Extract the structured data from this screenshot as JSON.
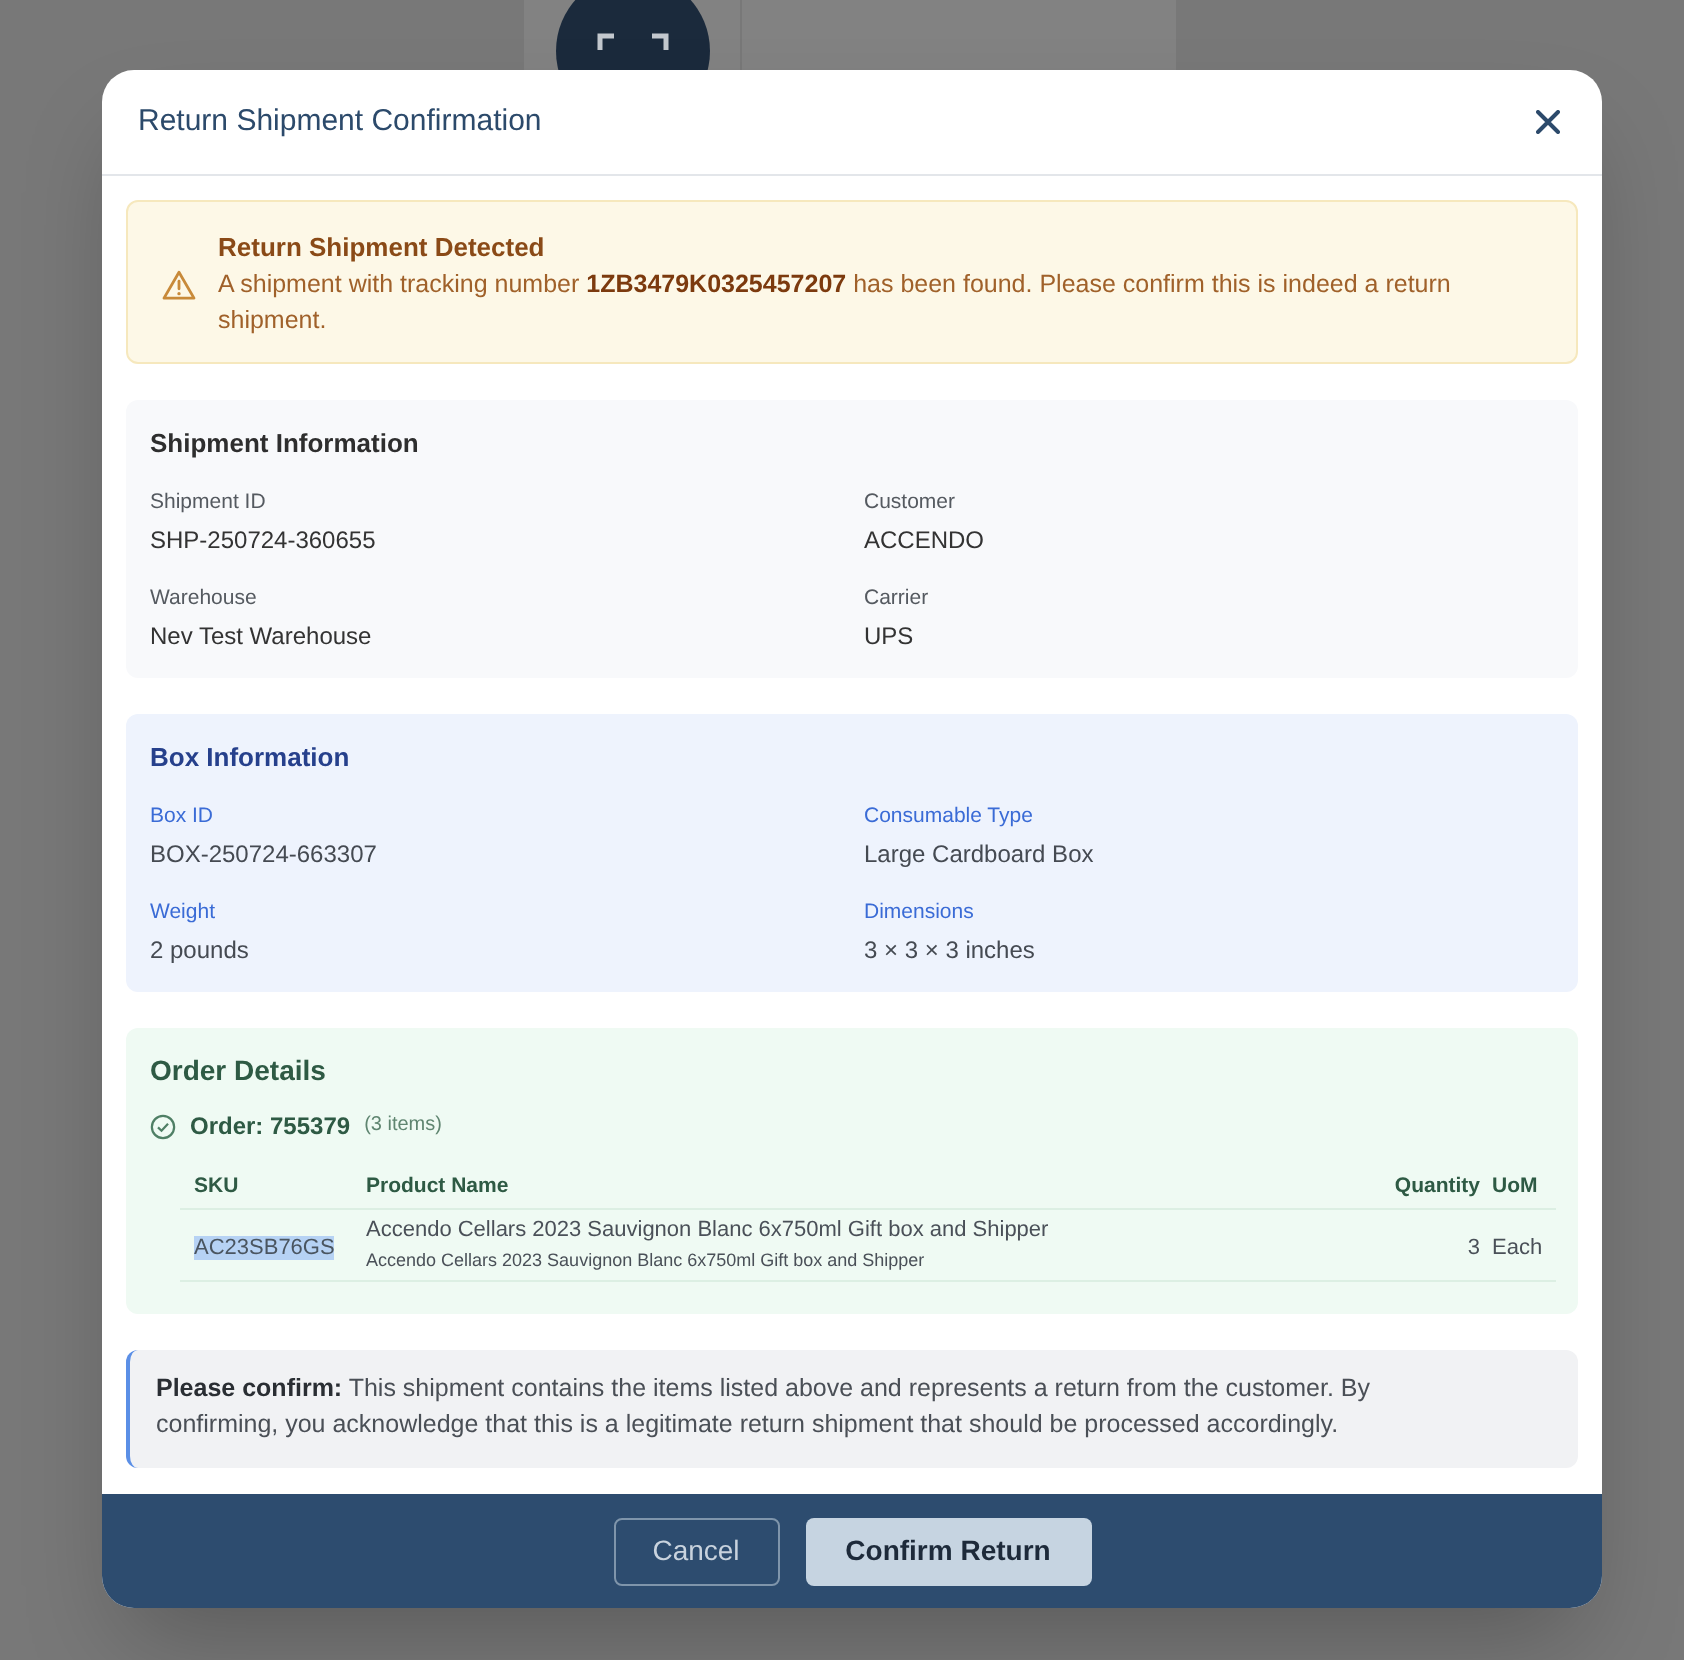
{
  "dialog": {
    "title": "Return Shipment Confirmation"
  },
  "alert": {
    "title": "Return Shipment Detected",
    "message": "A shipment with tracking number **1ZB3479K0325457207** has been found. Please confirm this is indeed a return shipment."
  },
  "sections": [
    {
      "kind": "neutral",
      "title": "Shipment Information",
      "fields": [
        {
          "label": "Shipment ID",
          "value": "SHP-250724-360655"
        },
        {
          "label": "Customer",
          "value": "ACCENDO"
        },
        {
          "label": "Warehouse",
          "value": "Nev Test Warehouse"
        },
        {
          "label": "Carrier",
          "value": "UPS"
        }
      ]
    },
    {
      "kind": "accent",
      "title": "Box Information",
      "fields": [
        {
          "label": "Box ID",
          "value": "BOX-250724-663307"
        },
        {
          "label": "Consumable Type",
          "value": "Large Cardboard Box"
        },
        {
          "label": "Weight",
          "value": "2 pounds"
        },
        {
          "label": "Dimensions",
          "value": "3 × 3 × 3 inches"
        }
      ]
    }
  ],
  "order_details": {
    "title": "Order Details",
    "order": {
      "label": "Order: 755379",
      "count": "(3 items)"
    },
    "columns": [
      "SKU",
      "Product Name",
      "Quantity",
      "UoM"
    ],
    "rows": [
      {
        "sku": "AC23SB76GS",
        "sku_selected": true,
        "product_name": "Accendo Cellars 2023 Sauvignon Blanc 6x750ml Gift box and Shipper",
        "description": "Accendo Cellars 2023 Sauvignon Blanc 6x750ml Gift box and Shipper",
        "quantity": "3",
        "uom": "Each"
      }
    ]
  },
  "note": "**Please confirm:** This shipment contains the items listed above and represents a return from the customer. By confirming, you acknowledge that this is a legitimate return shipment that should be processed accordingly.",
  "buttons": [
    {
      "kind": "secondary",
      "label": "Cancel"
    },
    {
      "kind": "primary",
      "label": "Confirm Return"
    }
  ]
}
